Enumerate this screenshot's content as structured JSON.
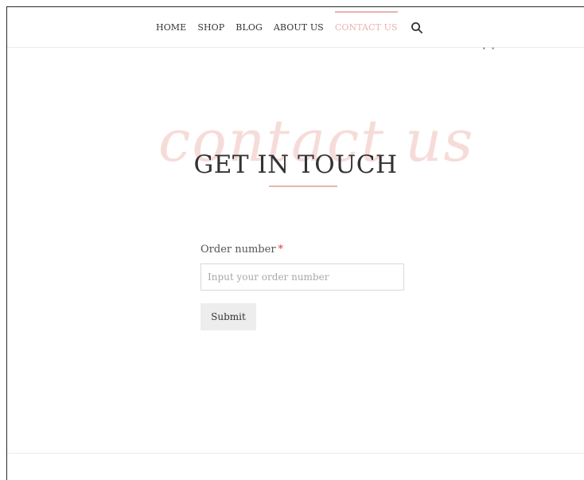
{
  "nav": {
    "items": [
      {
        "label": "HOME",
        "active": false
      },
      {
        "label": "SHOP",
        "active": false
      },
      {
        "label": "BLOG",
        "active": false
      },
      {
        "label": "ABOUT US",
        "active": false
      },
      {
        "label": "CONTACT US",
        "active": true
      }
    ],
    "search_icon": "search-icon",
    "active_color": "#e8b4b0"
  },
  "hero": {
    "script_text": "contact us",
    "title": "GET IN TOUCH",
    "accent_color": "#e8b4b0",
    "script_color": "#f6dcd9"
  },
  "form": {
    "order_label": "Order number",
    "required_marker": "*",
    "order_value": "",
    "order_placeholder": "Input your order number",
    "submit_label": "Submit",
    "required_color": "#e53935"
  }
}
